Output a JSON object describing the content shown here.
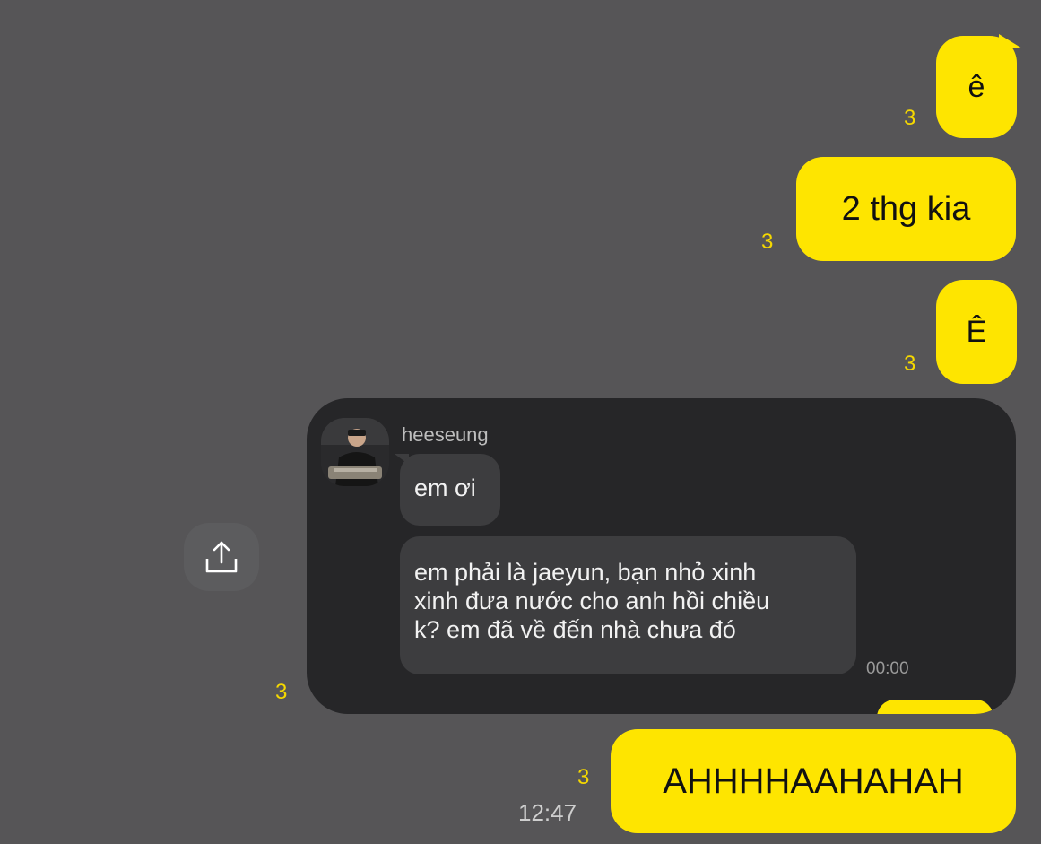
{
  "messages": {
    "m1": {
      "text": "ê",
      "unread": "3"
    },
    "m2": {
      "text": "2 thg kia",
      "unread": "3"
    },
    "m3": {
      "text": "Ê",
      "unread": "3"
    },
    "shared": {
      "unread": "3",
      "sender": "heeseung",
      "bubble1": "em ơi",
      "bubble2_lines": [
        "em phải là jaeyun, bạn nhỏ xinh",
        "xinh đưa nước cho anh hồi chiều",
        "k? em đã về đến nhà chưa đó"
      ],
      "time": "00:00"
    },
    "m5": {
      "text": "AHHHHAAHAHAH",
      "unread": "3",
      "time": "12:47"
    }
  },
  "icons": {
    "share": "share-upload-icon",
    "avatar": "user-avatar"
  },
  "colors": {
    "background": "#565557",
    "my_bubble": "#FEE500",
    "card": "#262628",
    "dark_bubble": "#3d3d3f",
    "unread": "#F5D800"
  }
}
